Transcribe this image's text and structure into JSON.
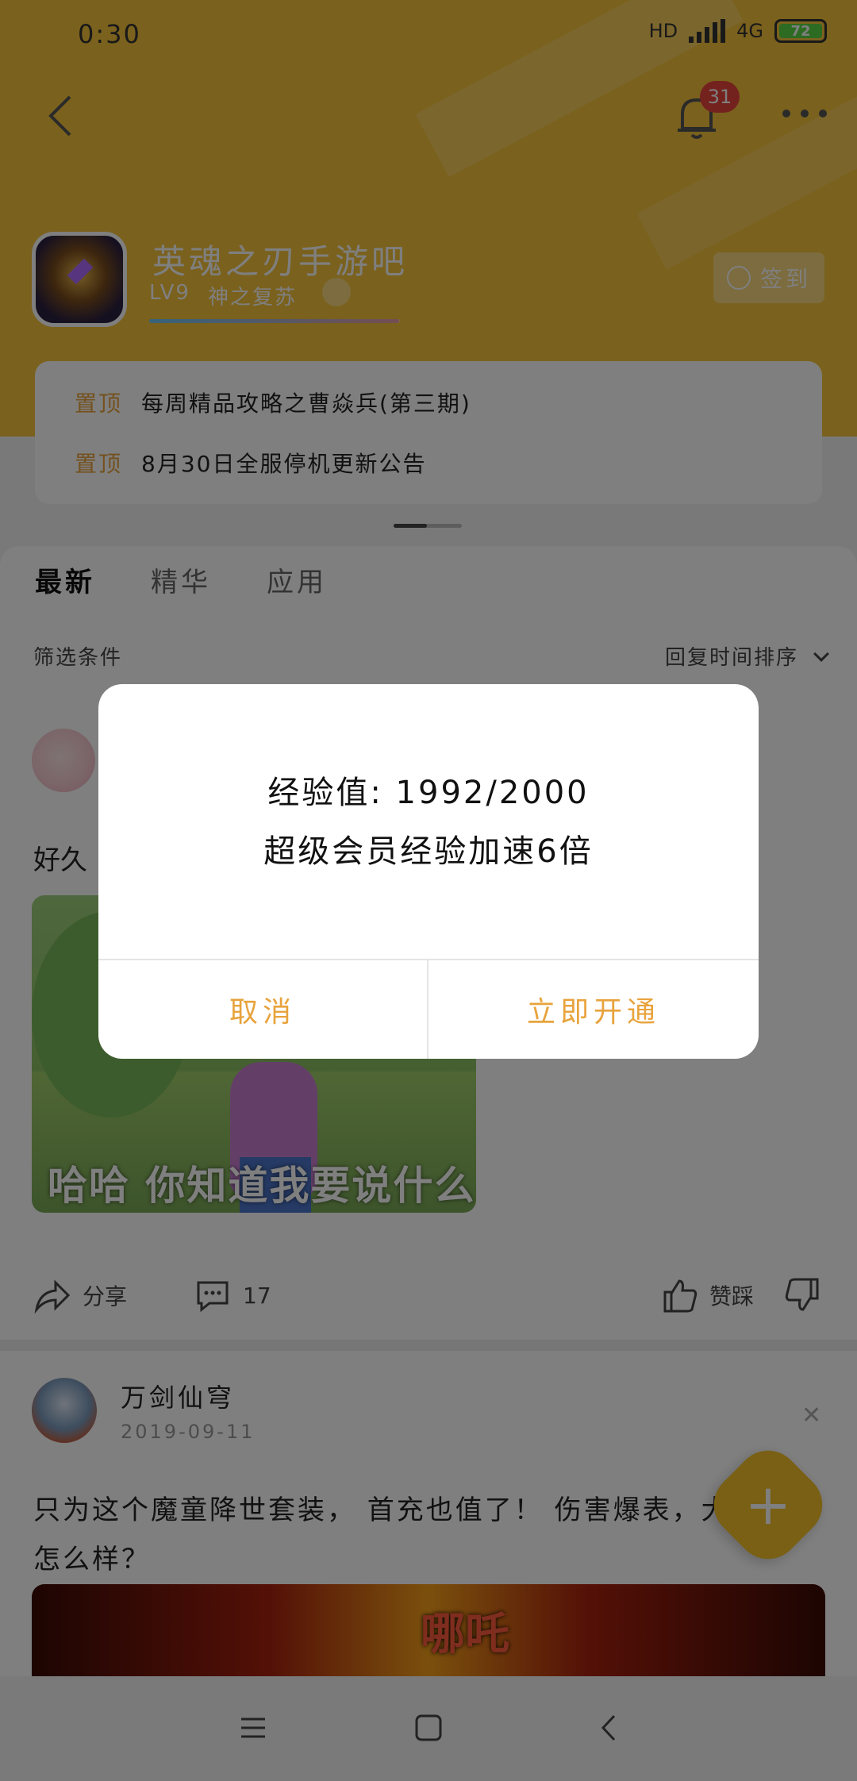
{
  "status_bar": {
    "time": "0:30",
    "network": "4G",
    "hd": "HD",
    "battery": "72"
  },
  "header": {
    "notification_count": "31",
    "forum_name": "英魂之刃手游吧",
    "level": "LV9",
    "level_title": "神之复苏",
    "level_progress": 0.996,
    "signin_label": "签到"
  },
  "pinned": [
    {
      "tag": "置顶",
      "text": "每周精品攻略之曹焱兵(第三期)"
    },
    {
      "tag": "置顶",
      "text": "8月30日全服停机更新公告"
    }
  ],
  "tabs": [
    "最新",
    "精华",
    "应用"
  ],
  "filter": {
    "label": "筛选条件",
    "sort": "回复时间排序"
  },
  "post1": {
    "text_partial": "好久",
    "image_caption": "哈哈 你知道我要说什么",
    "share_label": "分享",
    "comment_count": "17",
    "like_label": "赞踩"
  },
  "post2": {
    "author": "万剑仙穹",
    "date": "2019-09-11",
    "text": "只为这个魔童降世套装，  首充也值了！  伤害爆表，大家看看怎么样？",
    "banner_title": "哪吒"
  },
  "dialog": {
    "line1": "经验值: 1992/2000",
    "line2": "超级会员经验加速6倍",
    "cancel": "取消",
    "confirm": "立即开通"
  },
  "colors": {
    "header_bg": "#f5c33b",
    "accent": "#e8a33c",
    "badge": "#e8453c"
  }
}
